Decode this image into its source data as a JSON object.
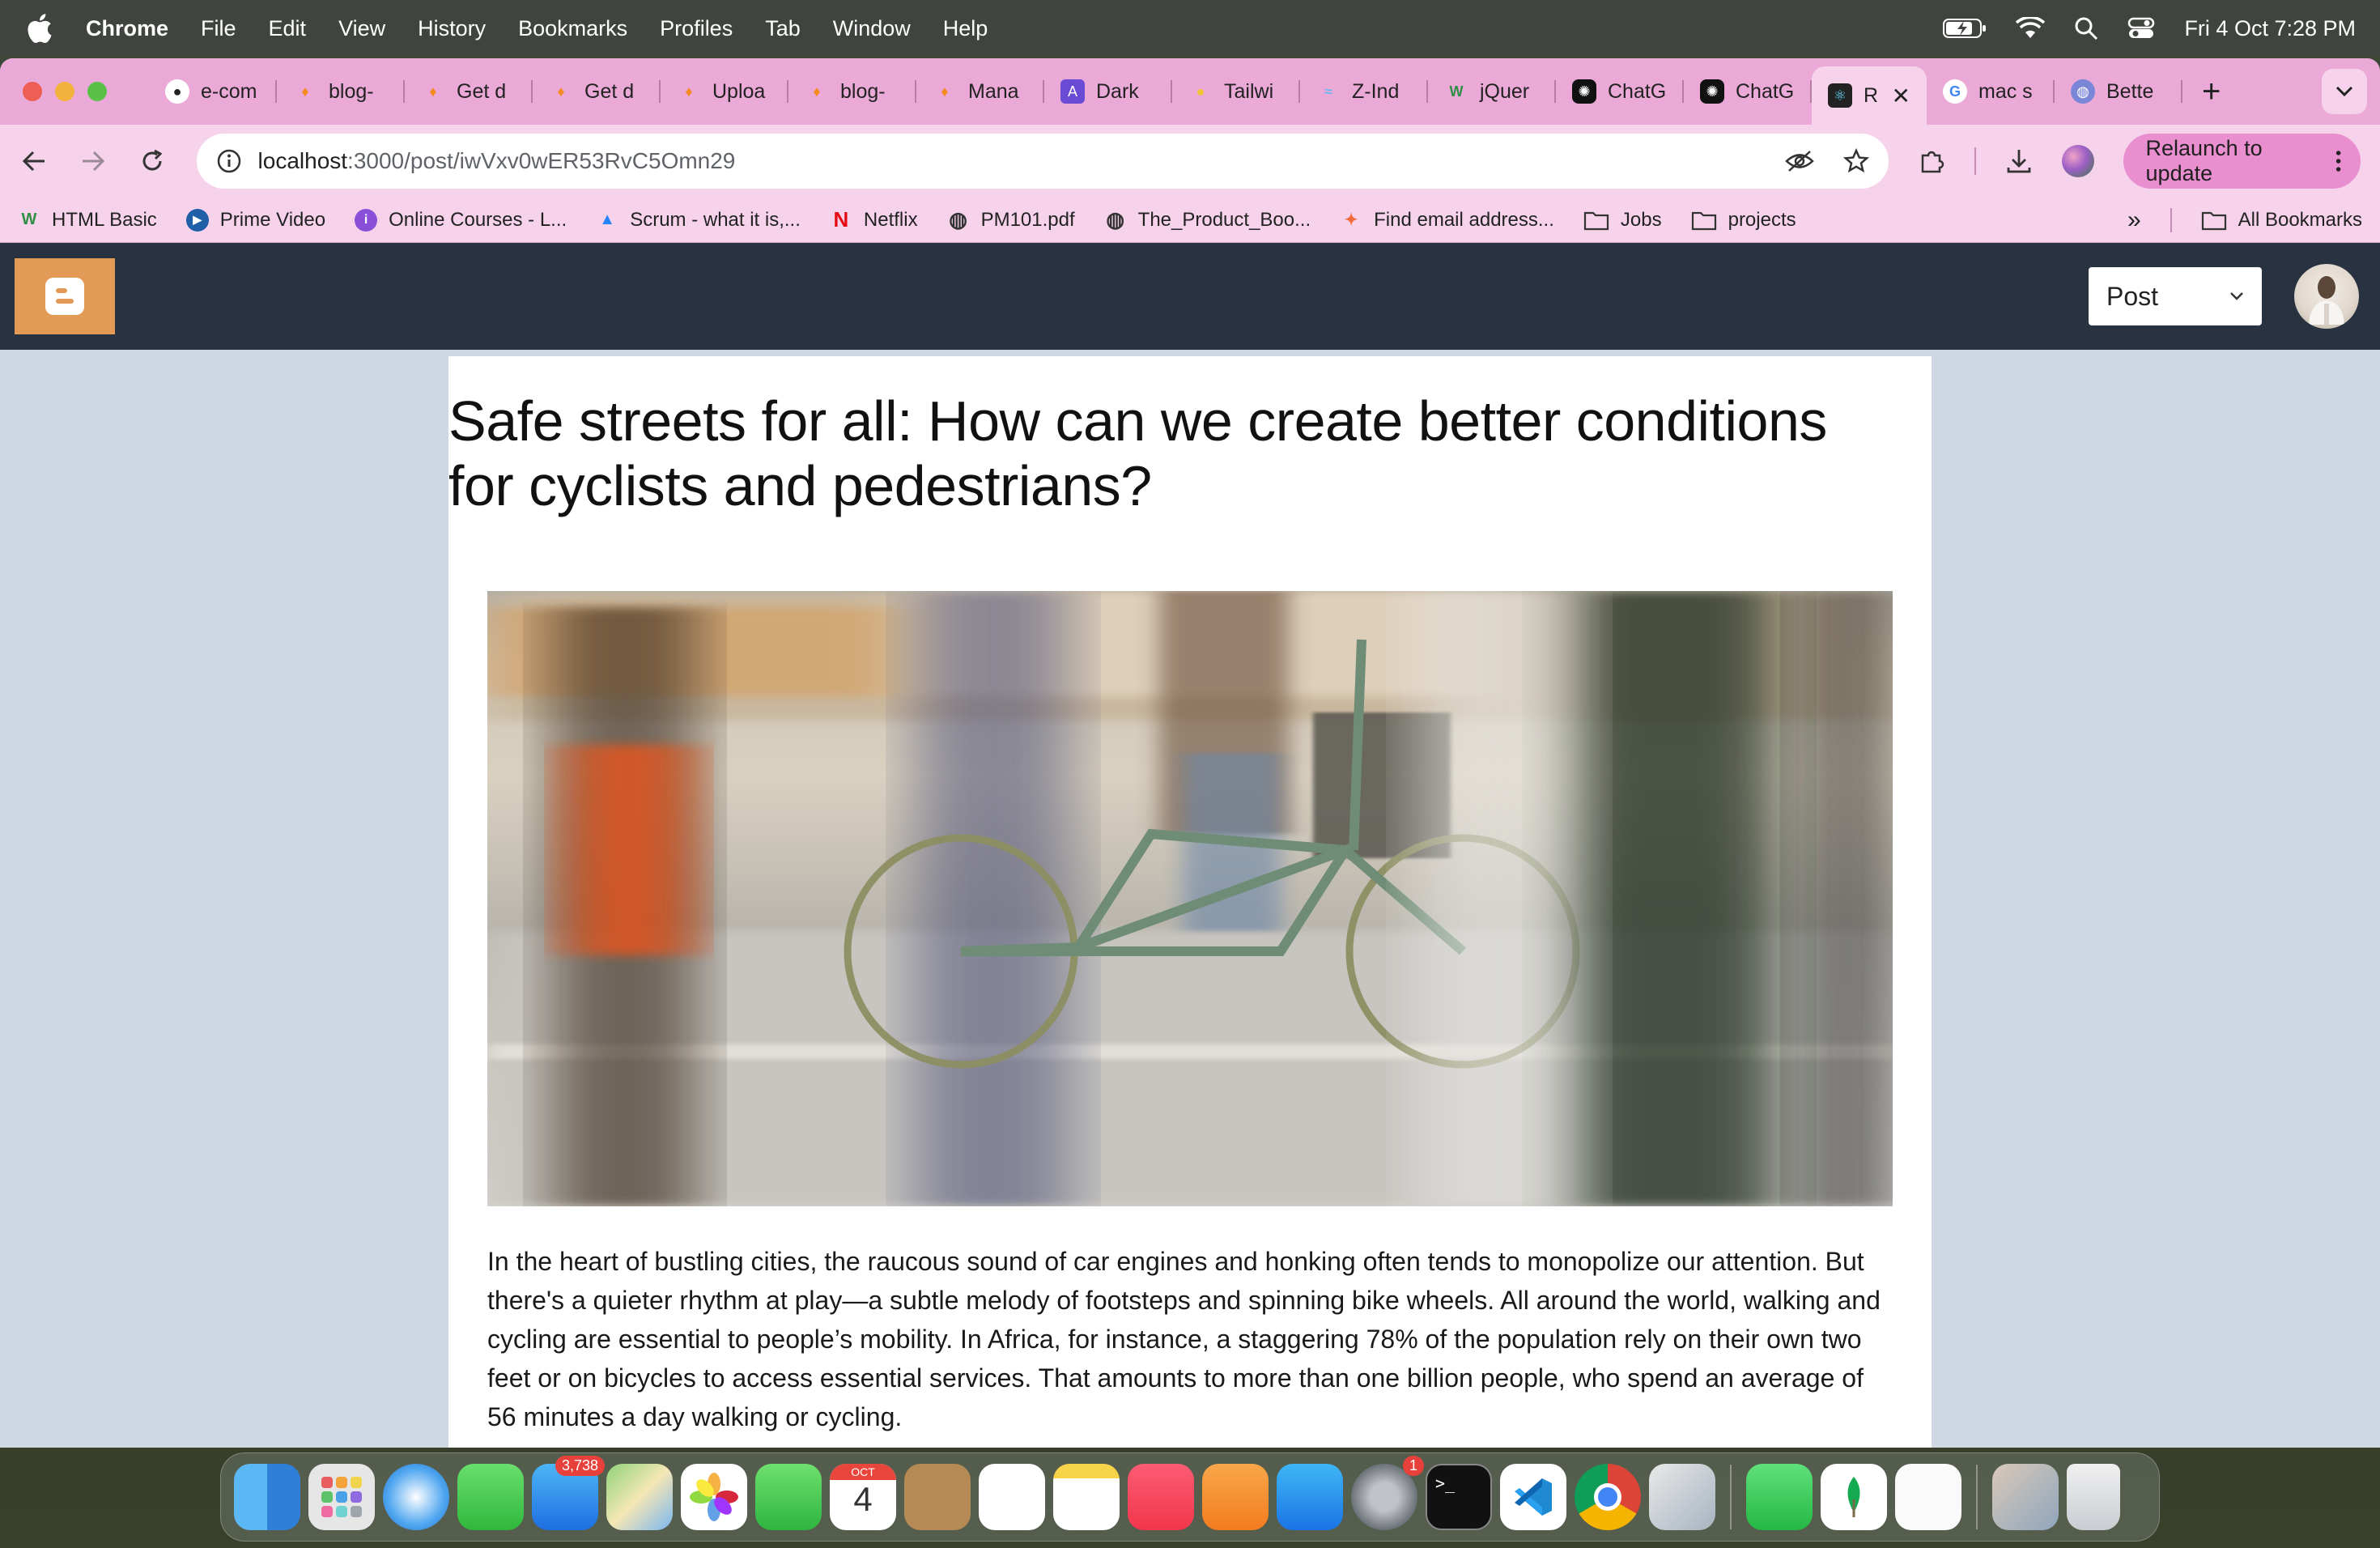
{
  "menubar": {
    "app": "Chrome",
    "items": [
      "File",
      "Edit",
      "View",
      "History",
      "Bookmarks",
      "Profiles",
      "Tab",
      "Window",
      "Help"
    ],
    "clock": "Fri 4 Oct  7:28 PM"
  },
  "tabs": [
    {
      "label": "e-com",
      "icon": "github-icon"
    },
    {
      "label": "blog-",
      "icon": "firebase-icon"
    },
    {
      "label": "Get d",
      "icon": "firebase-icon"
    },
    {
      "label": "Get d",
      "icon": "firebase-icon"
    },
    {
      "label": "Uploa",
      "icon": "firebase-icon"
    },
    {
      "label": "blog-",
      "icon": "firebase-icon"
    },
    {
      "label": "Mana",
      "icon": "firebase-icon"
    },
    {
      "label": "Dark",
      "icon": "app-icon"
    },
    {
      "label": "Tailwi",
      "icon": "pin-icon"
    },
    {
      "label": "Z-Ind",
      "icon": "tailwind-icon"
    },
    {
      "label": "jQuer",
      "icon": "w3-icon"
    },
    {
      "label": "ChatG",
      "icon": "openai-icon"
    },
    {
      "label": "ChatG",
      "icon": "openai-icon"
    },
    {
      "label": "R",
      "icon": "react-icon",
      "active": true
    },
    {
      "label": "mac s",
      "icon": "google-icon"
    },
    {
      "label": "Bette",
      "icon": "globe-icon"
    }
  ],
  "address": {
    "host": "localhost",
    "path": ":3000/post/iwVxv0wER53RvC5Omn29"
  },
  "relaunch_label": "Relaunch to update",
  "bookmarks": [
    {
      "label": "HTML Basic",
      "icon": "w3-icon"
    },
    {
      "label": "Prime Video",
      "icon": "play-icon"
    },
    {
      "label": "Online Courses - L...",
      "icon": "udemy-icon"
    },
    {
      "label": "Scrum - what it is,...",
      "icon": "atlassian-icon"
    },
    {
      "label": "Netflix",
      "icon": "netflix-icon"
    },
    {
      "label": "PM101.pdf",
      "icon": "globe-icon"
    },
    {
      "label": "The_Product_Boo...",
      "icon": "globe-icon"
    },
    {
      "label": "Find email address...",
      "icon": "hunter-icon"
    },
    {
      "label": "Jobs",
      "icon": "folder-icon"
    },
    {
      "label": "projects",
      "icon": "folder-icon"
    }
  ],
  "all_bookmarks": "All Bookmarks",
  "app": {
    "select_value": "Post"
  },
  "article": {
    "title": "Safe streets for all: How can we create better conditions for cyclists and pedestrians?",
    "body": "In the heart of bustling cities, the raucous sound of car engines and honking often tends to monopolize our attention. But there's a quieter rhythm at play—a subtle melody of footsteps and spinning bike wheels. All around the world, walking and cycling are essential to people’s mobility. In Africa, for instance, a staggering 78% of the population rely on their own two feet or on bicycles to access essential services. That amounts to more than one billion people, who spend an average of 56 minutes a day walking or cycling."
  },
  "dock": {
    "mail_badge": "3,738",
    "calendar_month": "OCT",
    "calendar_day": "4",
    "settings_badge": "1"
  }
}
